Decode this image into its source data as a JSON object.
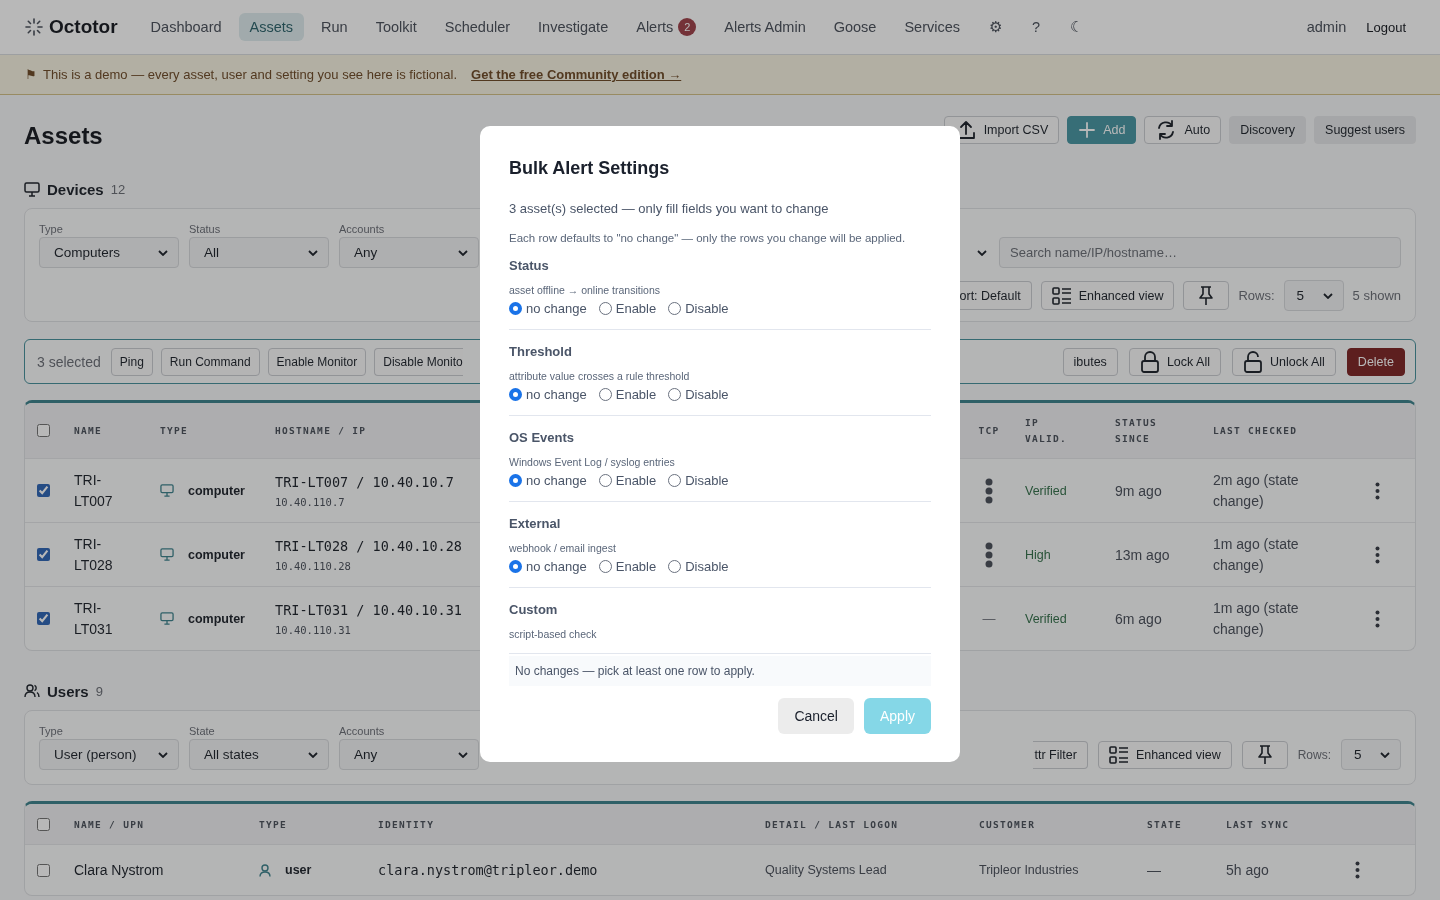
{
  "nav": {
    "brand": "Octotor",
    "items": [
      {
        "label": "Dashboard",
        "selected": false
      },
      {
        "label": "Assets",
        "selected": true
      },
      {
        "label": "Run",
        "selected": false
      },
      {
        "label": "Toolkit",
        "selected": false
      },
      {
        "label": "Scheduler",
        "selected": false
      },
      {
        "label": "Investigate",
        "selected": false
      },
      {
        "label": "Alerts",
        "selected": false,
        "badge": "2"
      },
      {
        "label": "Alerts Admin",
        "selected": false
      },
      {
        "label": "Goose",
        "selected": false
      },
      {
        "label": "Services",
        "selected": false
      }
    ],
    "icon_links": [
      "⚙",
      "?",
      "☾"
    ],
    "user": "admin",
    "logout": "Logout"
  },
  "banner": {
    "flag": "⚑",
    "text": "This is a demo — every asset, user and setting you see here is fictional.",
    "link": "Get the free Community edition →"
  },
  "page": {
    "title": "Assets",
    "actions": [
      {
        "label": "Import CSV",
        "kind": "upload"
      },
      {
        "label": "Add",
        "kind": "primary"
      },
      {
        "label": "Auto",
        "kind": "refresh"
      },
      {
        "label": "Discovery",
        "kind": "plain"
      },
      {
        "label": "Suggest users",
        "kind": "plain"
      }
    ]
  },
  "devices": {
    "title": "Devices",
    "count": "12",
    "filters": [
      {
        "label": "Type",
        "value": "Computers"
      },
      {
        "label": "Status",
        "value": "All"
      },
      {
        "label": "Accounts",
        "value": "Any"
      }
    ],
    "search": {
      "placeholder": "Search name/IP/hostname…"
    },
    "sort": "ort: Default",
    "view": "Enhanced view",
    "rows_label": "Rows:",
    "rows_value": "5",
    "shown": "5 shown"
  },
  "bulk": {
    "selected_text": "3 selected",
    "left_actions": [
      "Ping",
      "Run Command",
      "Enable Monitor",
      "Disable Monito"
    ],
    "right_actions": [
      {
        "label": "ibutes",
        "kind": "plain"
      },
      {
        "label": "Lock All",
        "kind": "lock"
      },
      {
        "label": "Unlock All",
        "kind": "unlock"
      },
      {
        "label": "Delete",
        "kind": "danger"
      }
    ]
  },
  "devices_table": {
    "all_checked": false,
    "columns": [
      "NAME",
      "TYPE",
      "HOSTNAME / IP",
      "TCP",
      "IP VALID.",
      "STATUS SINCE",
      "LAST CHECKED"
    ],
    "rows": [
      {
        "selected": true,
        "name": "TRI-LT007",
        "type": "computer",
        "hostname": "TRI-LT007 / 10.40.10.7",
        "ip": "10.40.110.7",
        "tcp": {
          "kind": "dots"
        },
        "ip_valid": "Verified",
        "status_since": "9m ago",
        "last_checked": "2m ago (state change)"
      },
      {
        "selected": true,
        "name": "TRI-LT028",
        "type": "computer",
        "hostname": "TRI-LT028 / 10.40.10.28",
        "ip": "10.40.110.28",
        "tcp": {
          "kind": "dots"
        },
        "ip_valid": "High",
        "status_since": "13m ago",
        "last_checked": "1m ago (state change)"
      },
      {
        "selected": true,
        "name": "TRI-LT031",
        "type": "computer",
        "hostname": "TRI-LT031 / 10.40.10.31",
        "ip": "10.40.110.31",
        "tcp": {
          "kind": "text",
          "text": "—"
        },
        "ip_valid": "Verified",
        "status_since": "6m ago",
        "last_checked": "1m ago (state change)"
      }
    ]
  },
  "users": {
    "title": "Users",
    "count": "9",
    "filters": [
      {
        "label": "Type",
        "value": "User (person)"
      },
      {
        "label": "State",
        "value": "All states"
      },
      {
        "label": "Accounts",
        "value": "Any"
      }
    ],
    "attr_filter": "ttr Filter",
    "view": "Enhanced view",
    "rows_label": "Rows:",
    "rows_value": "5"
  },
  "users_table": {
    "all_checked": false,
    "columns": [
      "NAME / UPN",
      "TYPE",
      "IDENTITY",
      "DETAIL / LAST LOGON",
      "CUSTOMER",
      "STATE",
      "LAST SYNC"
    ],
    "rows": [
      {
        "selected": false,
        "name": "Clara Nystrom",
        "type": "user",
        "identity": "clara.nystrom@tripleor.demo",
        "detail": "Quality Systems Lead",
        "customer": "Tripleor Industries",
        "state": "—",
        "last_sync": "5h ago"
      }
    ]
  },
  "modal": {
    "title": "Bulk Alert Settings",
    "intro": "3 asset(s) selected — only fill fields you want to change",
    "note": "Each row defaults to \"no change\" — only the rows you change will be applied.",
    "sections": [
      {
        "title": "Status",
        "description": "asset offline → online transitions",
        "options": [
          {
            "label": "no change",
            "selected": true
          },
          {
            "label": "Enable",
            "selected": false
          },
          {
            "label": "Disable",
            "selected": false
          }
        ]
      },
      {
        "title": "Threshold",
        "description": "attribute value crosses a rule threshold",
        "options": [
          {
            "label": "no change",
            "selected": true
          },
          {
            "label": "Enable",
            "selected": false
          },
          {
            "label": "Disable",
            "selected": false
          }
        ]
      },
      {
        "title": "OS Events",
        "description": "Windows Event Log / syslog entries",
        "options": [
          {
            "label": "no change",
            "selected": true
          },
          {
            "label": "Enable",
            "selected": false
          },
          {
            "label": "Disable",
            "selected": false
          }
        ]
      },
      {
        "title": "External",
        "description": "webhook / email ingest",
        "options": [
          {
            "label": "no change",
            "selected": true
          },
          {
            "label": "Enable",
            "selected": false
          },
          {
            "label": "Disable",
            "selected": false
          }
        ]
      },
      {
        "title": "Custom",
        "description": "script-based check"
      }
    ],
    "footer_note": "No changes — pick at least one row to apply.",
    "buttons": [
      {
        "label": "Cancel",
        "kind": "secondary",
        "disabled": false
      },
      {
        "label": "Apply",
        "kind": "primary",
        "disabled": true
      }
    ]
  }
}
